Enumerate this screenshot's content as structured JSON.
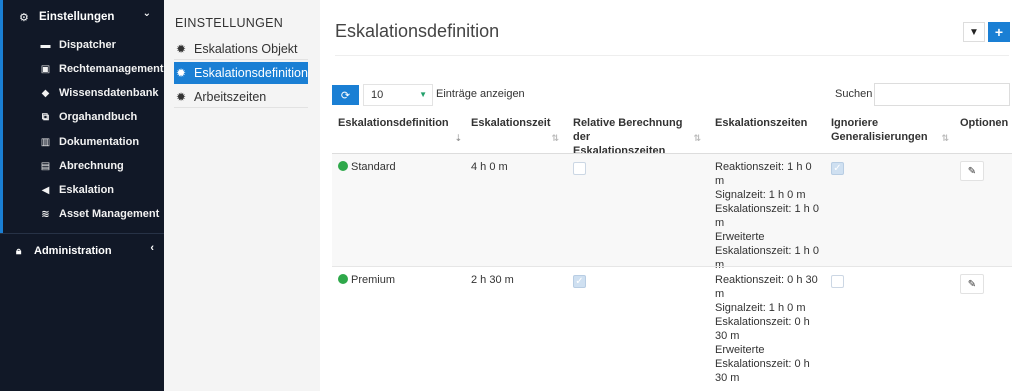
{
  "sidebar": {
    "header": {
      "label": "Einstellungen",
      "icon": "gears-icon"
    },
    "items": [
      {
        "label": "Dispatcher",
        "icon": "dispatcher-icon"
      },
      {
        "label": "Rechtemanagement",
        "icon": "id-card-icon"
      },
      {
        "label": "Wissensdatenbank",
        "icon": "graduation-cap-icon"
      },
      {
        "label": "Orgahandbuch",
        "icon": "sitemap-icon"
      },
      {
        "label": "Dokumentation",
        "icon": "books-icon"
      },
      {
        "label": "Abrechnung",
        "icon": "invoice-icon"
      },
      {
        "label": "Eskalation",
        "icon": "megaphone-icon"
      },
      {
        "label": "Asset Management",
        "icon": "layers-icon"
      }
    ],
    "admin": {
      "label": "Administration",
      "icon": "lock-icon"
    }
  },
  "midnav": {
    "title": "EINSTELLUNGEN",
    "items": [
      {
        "label": "Eskalations Objekt"
      },
      {
        "label": "Eskalationsdefinition"
      },
      {
        "label": "Arbeitszeiten"
      }
    ]
  },
  "main": {
    "title": "Eskalationsdefinition",
    "page_length": "10",
    "page_length_label": "Einträge anzeigen",
    "search_label": "Suchen",
    "search_value": "",
    "columns": [
      "Eskalationsdefinition",
      "Eskalationszeit",
      "Relative Berechnung der Eskalationszeiten",
      "Eskalationszeiten",
      "Ignoriere Generalisierungen",
      "Optionen"
    ],
    "rows": [
      {
        "name": "Standard",
        "zeit": "4 h 0 m",
        "relative": false,
        "zeiten": "Reaktionszeit: 1 h 0 m\nSignalzeit: 1 h 0 m\nEskalationszeit: 1 h 0 m\nErweiterte Eskalationszeit: 1 h 0 m",
        "ignore": true
      },
      {
        "name": "Premium",
        "zeit": "2 h 30 m",
        "relative": true,
        "zeiten": "Reaktionszeit: 0 h 30 m\nSignalzeit: 1 h 0 m\nEskalationszeit: 0 h 30 m\nErweiterte Eskalationszeit: 0 h 30 m",
        "ignore": false
      }
    ]
  },
  "colors": {
    "accent": "#1a7fd4",
    "sidebar": "#111827",
    "status_active": "#2ea84a"
  }
}
